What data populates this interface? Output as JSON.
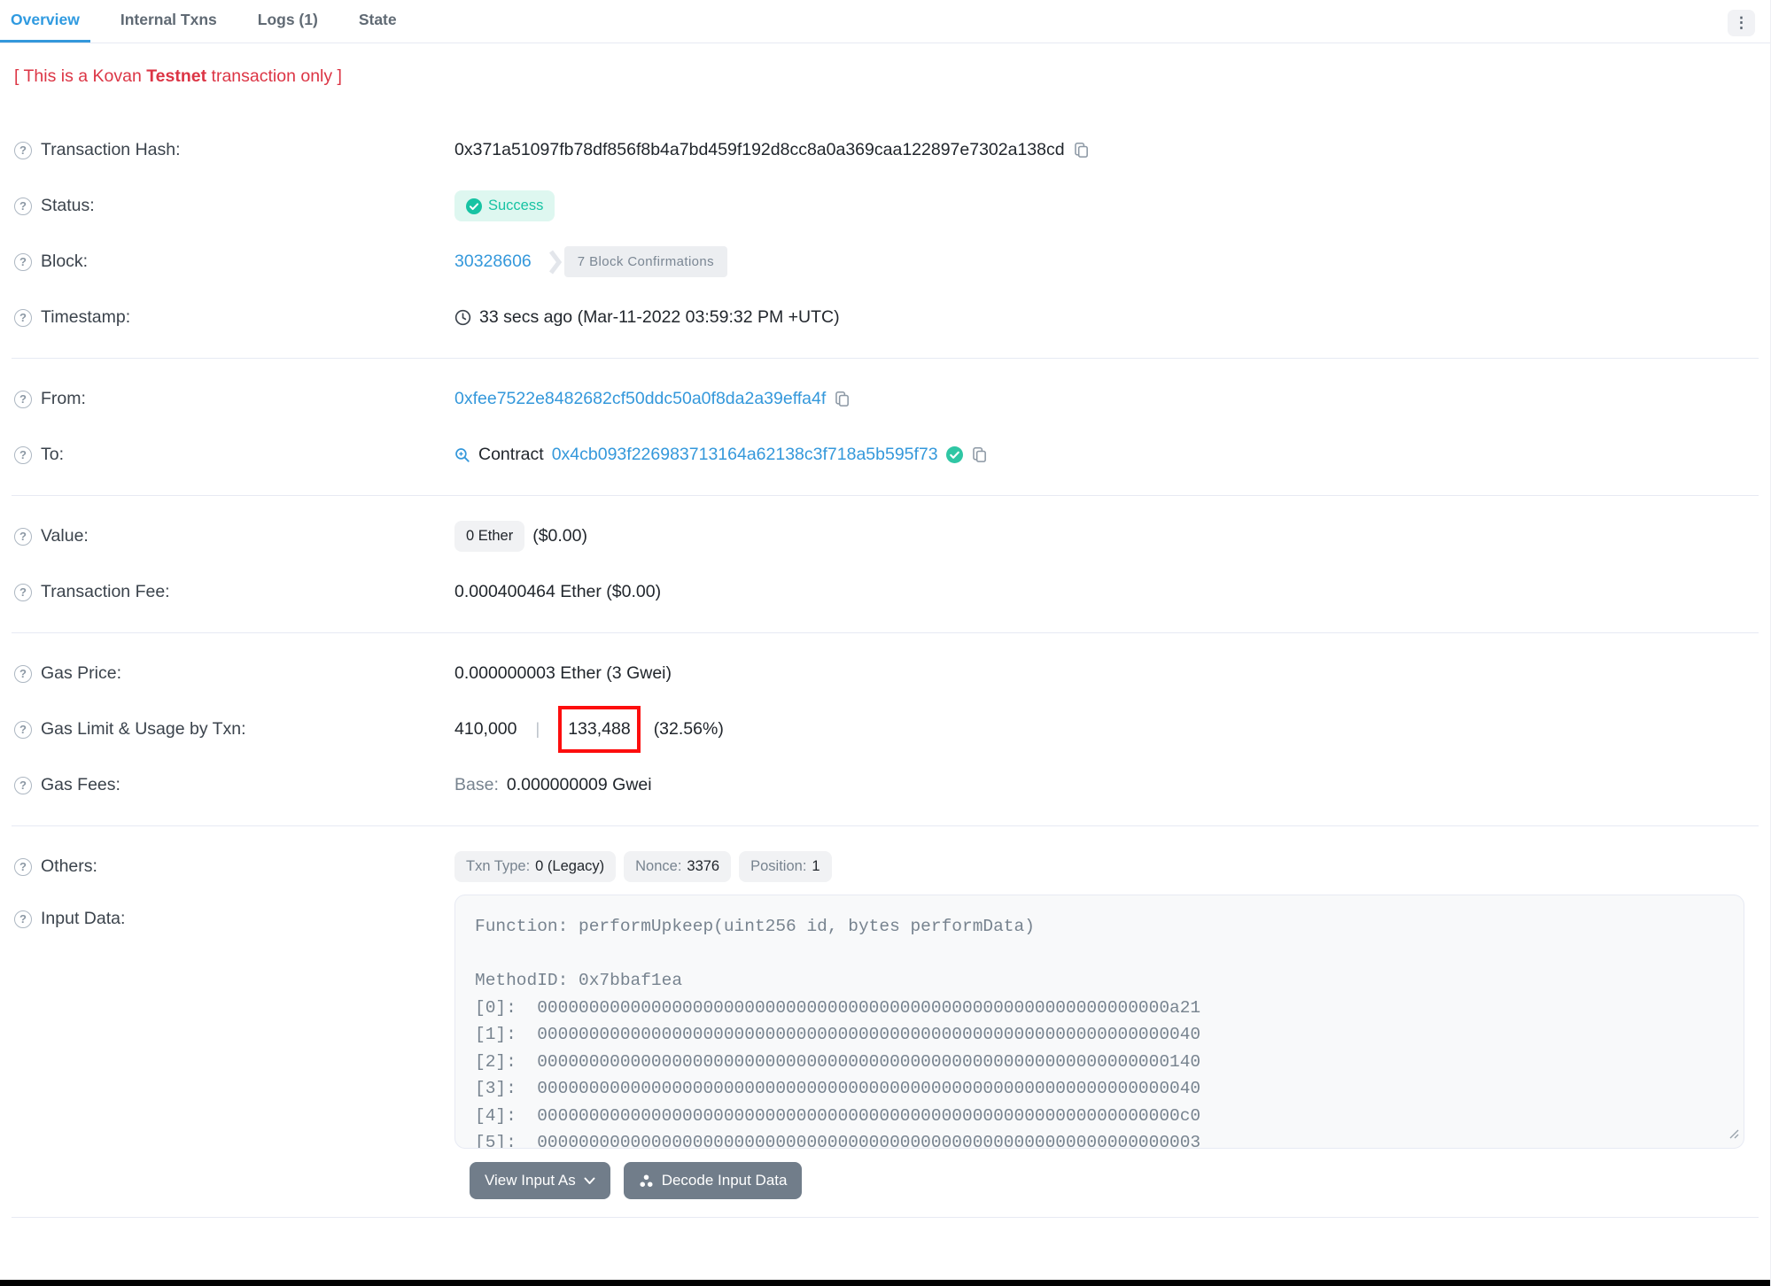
{
  "colors": {
    "accent_blue": "#3498db",
    "success_teal": "#17c3a3",
    "success_bg": "#def7f0",
    "notice_red": "#dc3545",
    "highlight_red": "#fd0d0d",
    "muted_gray": "#77838f",
    "badge_bg": "#f1f2f4",
    "divider": "#e7eaf3",
    "button_slate": "#717d8a"
  },
  "icons": {
    "help": "?",
    "kebab": "⋮"
  },
  "tabs": {
    "items": [
      {
        "label": "Overview",
        "active": true
      },
      {
        "label": "Internal Txns",
        "active": false
      },
      {
        "label": "Logs (1)",
        "active": false
      },
      {
        "label": "State",
        "active": false
      }
    ]
  },
  "notice": {
    "prefix": "[ This is a Kovan ",
    "bold": "Testnet",
    "suffix": " transaction only ]"
  },
  "fields": {
    "transaction_hash": {
      "label": "Transaction Hash:",
      "value": "0x371a51097fb78df856f8b4a7bd459f192d8cc8a0a369caa122897e7302a138cd"
    },
    "status": {
      "label": "Status:",
      "value": "Success"
    },
    "block": {
      "label": "Block:",
      "number": "30328606",
      "confirmations": "7 Block Confirmations"
    },
    "timestamp": {
      "label": "Timestamp:",
      "value": "33 secs ago (Mar-11-2022 03:59:32 PM +UTC)"
    },
    "from": {
      "label": "From:",
      "value": "0xfee7522e8482682cf50ddc50a0f8da2a39effa4f"
    },
    "to": {
      "label": "To:",
      "prefix": "Contract",
      "value": "0x4cb093f226983713164a62138c3f718a5b595f73"
    },
    "value": {
      "label": "Value:",
      "badge": "0 Ether",
      "usd": "($0.00)"
    },
    "transaction_fee": {
      "label": "Transaction Fee:",
      "value": "0.000400464 Ether ($0.00)"
    },
    "gas_price": {
      "label": "Gas Price:",
      "value": "0.000000003 Ether (3 Gwei)"
    },
    "gas_limit_usage": {
      "label": "Gas Limit & Usage by Txn:",
      "limit": "410,000",
      "separator": "|",
      "used": "133,488",
      "percent": "(32.56%)"
    },
    "gas_fees": {
      "label": "Gas Fees:",
      "base_label": "Base:",
      "base_value": "0.000000009 Gwei"
    },
    "others": {
      "label": "Others:",
      "badges": [
        {
          "label": "Txn Type:",
          "value": "0 (Legacy)"
        },
        {
          "label": "Nonce:",
          "value": "3376"
        },
        {
          "label": "Position:",
          "value": "1"
        }
      ]
    },
    "input_data": {
      "label": "Input Data:",
      "text": "Function: performUpkeep(uint256 id, bytes performData)\n\nMethodID: 0x7bbaf1ea\n[0]:  0000000000000000000000000000000000000000000000000000000000000a21\n[1]:  0000000000000000000000000000000000000000000000000000000000000040\n[2]:  0000000000000000000000000000000000000000000000000000000000000140\n[3]:  0000000000000000000000000000000000000000000000000000000000000040\n[4]:  00000000000000000000000000000000000000000000000000000000000000c0\n[5]:  0000000000000000000000000000000000000000000000000000000000000003",
      "view_input_as_label": "View Input As",
      "decode_button_label": "Decode Input Data"
    }
  }
}
